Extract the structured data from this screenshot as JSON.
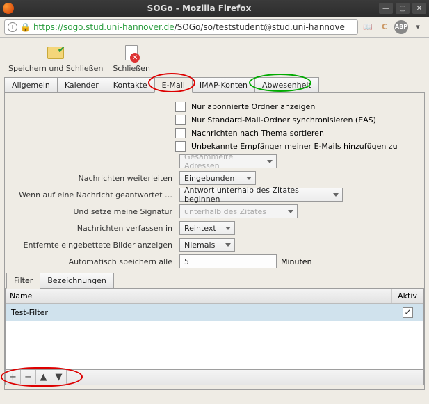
{
  "window": {
    "title": "SOGo - Mozilla Firefox"
  },
  "urlbar": {
    "scheme": "https",
    "secure_host": "://sogo.stud.uni-hannover.de",
    "rest": "/SOGo/so/teststudent@stud.uni-hannove"
  },
  "toolbar": {
    "save_close": "Speichern und Schließen",
    "close": "Schließen"
  },
  "tabs": {
    "allgemein": "Allgemein",
    "kalender": "Kalender",
    "kontakte": "Kontakte",
    "email": "E-Mail",
    "imap": "IMAP-Konten",
    "abwesenheit": "Abwesenheit"
  },
  "checkboxes": {
    "abonnierte": "Nur abonnierte Ordner anzeigen",
    "eas": "Nur Standard-Mail-Ordner synchronisieren (EAS)",
    "thema": "Nachrichten nach Thema sortieren",
    "unbekannte": "Unbekannte Empfänger meiner E-Mails hinzufügen zu"
  },
  "selects": {
    "gesammelte": "Gesammelte Adressen",
    "weiterleiten_label": "Nachrichten weiterleiten",
    "weiterleiten_value": "Eingebunden",
    "antwort_label": "Wenn auf eine Nachricht geantwortet …",
    "antwort_value": "Antwort unterhalb des Zitates beginnen",
    "signatur_label": "Und setze meine Signatur",
    "signatur_value": "unterhalb des Zitates",
    "verfassen_label": "Nachrichten verfassen in",
    "verfassen_value": "Reintext",
    "bilder_label": "Entfernte eingebettete Bilder anzeigen",
    "bilder_value": "Niemals",
    "autosave_label": "Automatisch speichern alle",
    "autosave_value": "5",
    "autosave_unit": "Minuten"
  },
  "subtabs": {
    "filter": "Filter",
    "bezeichnungen": "Bezeichnungen"
  },
  "table": {
    "col_name": "Name",
    "col_aktiv": "Aktiv",
    "rows": [
      {
        "name": "Test-Filter",
        "aktiv": true
      }
    ]
  },
  "foot": {
    "add": "+",
    "remove": "−",
    "up": "▲",
    "down": "▼"
  }
}
